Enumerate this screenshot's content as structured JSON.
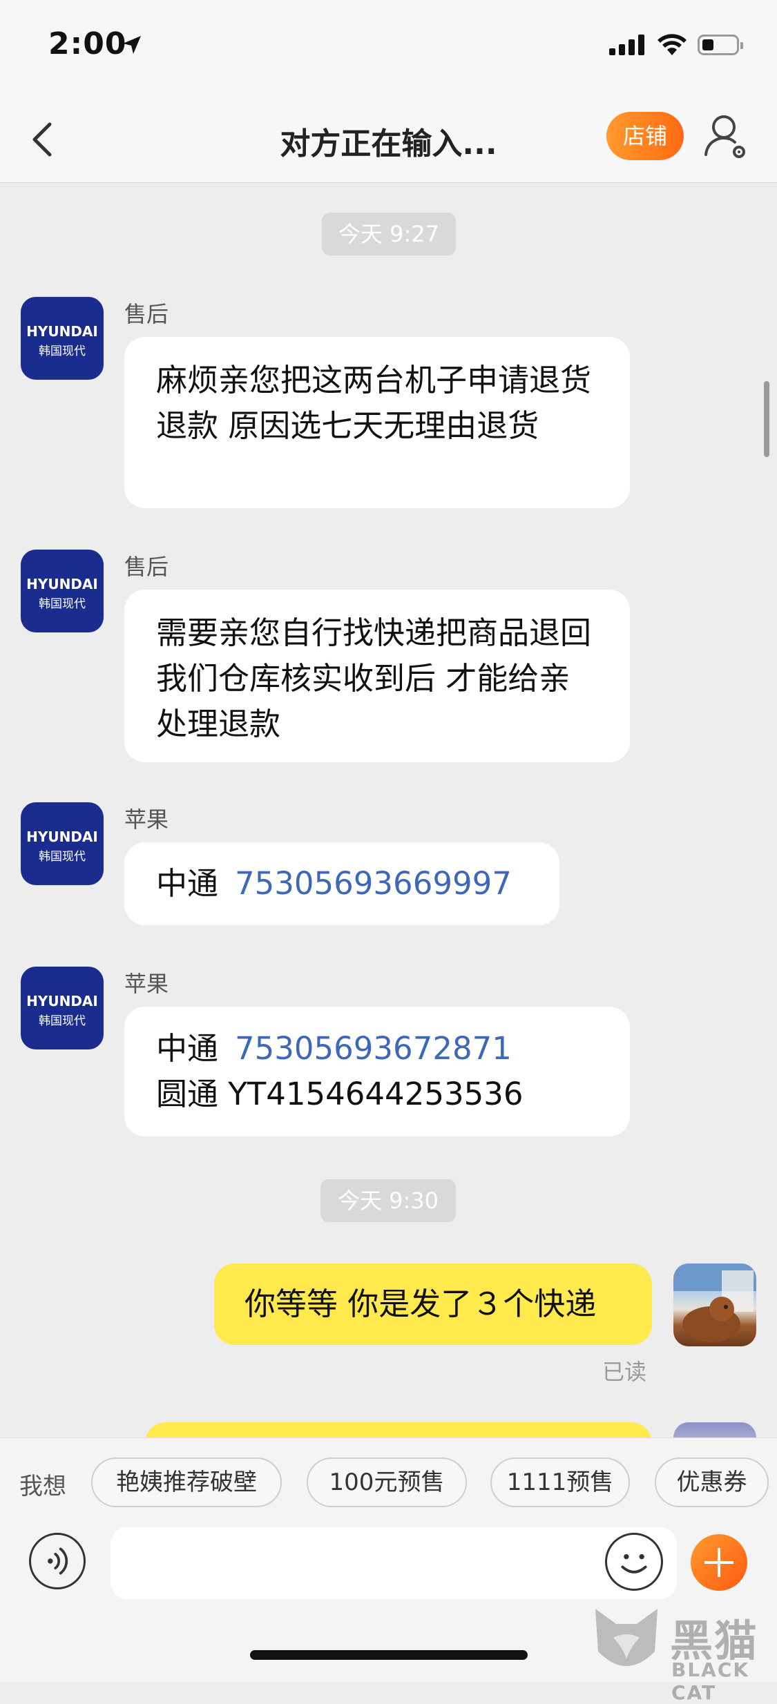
{
  "status_bar": {
    "time": "2:00"
  },
  "nav": {
    "title": "对方正在输入...",
    "shop_label": "店铺"
  },
  "timestamps": [
    "今天 9:27",
    "今天 9:30"
  ],
  "messages": [
    {
      "avatar_brand": "HYUNDAI",
      "avatar_sub": "韩国现代",
      "sender": "售后",
      "text": "麻烦亲您把这两台机子申请退货退款 原因选七天无理由退货"
    },
    {
      "avatar_brand": "HYUNDAI",
      "avatar_sub": "韩国现代",
      "sender": "售后",
      "text": "需要亲您自行找快递把商品退回 我们仓库核实收到后 才能给亲处理退款"
    },
    {
      "avatar_brand": "HYUNDAI",
      "avatar_sub": "韩国现代",
      "sender": "苹果",
      "carrier": "中通",
      "tracking": "75305693669997"
    },
    {
      "avatar_brand": "HYUNDAI",
      "avatar_sub": "韩国现代",
      "sender": "苹果",
      "carrier": "中通",
      "tracking": "75305693672871",
      "line2": "圆通 YT4154644253536"
    }
  ],
  "my_messages": [
    {
      "text": "你等等 你是发了３个快递",
      "status": "已读"
    }
  ],
  "quick_replies": {
    "label": "我想",
    "chips": [
      "艳姨推荐破壁",
      "100元预售",
      "1111预售",
      "优惠券"
    ]
  },
  "input": {
    "placeholder": ""
  },
  "watermark": {
    "text": "黑猫",
    "sub": "BLACK CAT"
  },
  "colors": {
    "accent": "#ff6a13",
    "my_bubble": "#ffe94d",
    "link": "#3d68b8",
    "brand_avatar": "#1a2d8f"
  }
}
